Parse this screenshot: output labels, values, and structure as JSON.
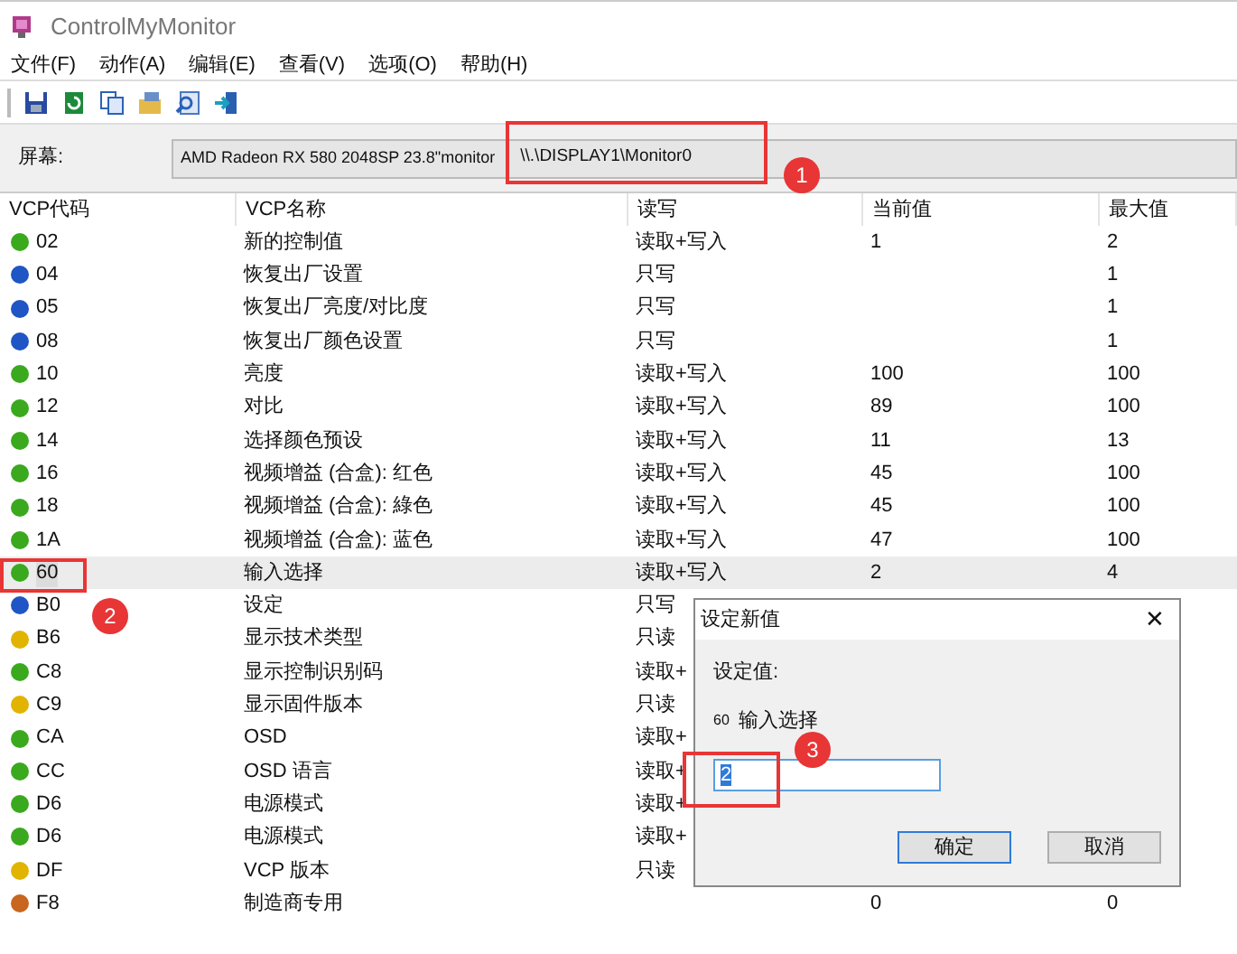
{
  "window": {
    "title": "ControlMyMonitor"
  },
  "menu": [
    "文件(F)",
    "动作(A)",
    "编辑(E)",
    "查看(V)",
    "选项(O)",
    "帮助(H)"
  ],
  "screen": {
    "label": "屏幕:",
    "monitor": "AMD Radeon RX 580 2048SP  23.8\"monitor",
    "device": "\\\\.\\DISPLAY1\\Monitor0"
  },
  "table": {
    "columns": [
      "VCP代码",
      "VCP名称",
      "读写",
      "当前值",
      "最大值"
    ],
    "rows": [
      {
        "code": "02",
        "name": "新的控制值",
        "rw": "读取+写入",
        "current": "1",
        "max": "2",
        "color": "#3aa91e",
        "selected": false
      },
      {
        "code": "04",
        "name": "恢复出厂设置",
        "rw": "只写",
        "max": "1",
        "color": "#1f55c4",
        "selected": false
      },
      {
        "code": "05",
        "name": "恢复出厂亮度/对比度",
        "rw": "只写",
        "max": "1",
        "color": "#1f55c4",
        "selected": false
      },
      {
        "code": "08",
        "name": "恢复出厂颜色设置",
        "rw": "只写",
        "max": "1",
        "color": "#1f55c4",
        "selected": false
      },
      {
        "code": "10",
        "name": "亮度",
        "rw": "读取+写入",
        "current": "100",
        "max": "100",
        "color": "#3aa91e",
        "selected": false
      },
      {
        "code": "12",
        "name": "对比",
        "rw": "读取+写入",
        "current": "89",
        "max": "100",
        "color": "#3aa91e",
        "selected": false
      },
      {
        "code": "14",
        "name": "选择颜色预设",
        "rw": "读取+写入",
        "current": "11",
        "max": "13",
        "color": "#3aa91e",
        "selected": false
      },
      {
        "code": "16",
        "name": "视频增益 (合盒): 红色",
        "rw": "读取+写入",
        "current": "45",
        "max": "100",
        "color": "#3aa91e",
        "selected": false
      },
      {
        "code": "18",
        "name": "视频增益 (合盒): 綠色",
        "rw": "读取+写入",
        "current": "45",
        "max": "100",
        "color": "#3aa91e",
        "selected": false
      },
      {
        "code": "1A",
        "name": "视频增益 (合盒): 蓝色",
        "rw": "读取+写入",
        "current": "47",
        "max": "100",
        "color": "#3aa91e",
        "selected": false
      },
      {
        "code": "60",
        "name": "输入选择",
        "rw": "读取+写入",
        "current": "2",
        "max": "4",
        "color": "#3aa91e",
        "selected": true
      },
      {
        "code": "B0",
        "name": "设定",
        "rw": "只写",
        "color": "#1f55c4",
        "selected": false
      },
      {
        "code": "B6",
        "name": "显示技术类型",
        "rw": "只读",
        "color": "#e0b400",
        "selected": false
      },
      {
        "code": "C8",
        "name": "显示控制识别码",
        "rw": "读取+",
        "color": "#3aa91e",
        "selected": false
      },
      {
        "code": "C9",
        "name": "显示固件版本",
        "rw": "只读",
        "color": "#e0b400",
        "selected": false
      },
      {
        "code": "CA",
        "name": "OSD",
        "rw": "读取+",
        "color": "#3aa91e",
        "selected": false
      },
      {
        "code": "CC",
        "name": "OSD 语言",
        "rw": "读取+",
        "color": "#3aa91e",
        "selected": false
      },
      {
        "code": "D6",
        "name": "电源模式",
        "rw": "读取+",
        "color": "#3aa91e",
        "selected": false
      },
      {
        "code": "D6",
        "name": "电源模式",
        "rw": "读取+",
        "color": "#3aa91e",
        "selected": false
      },
      {
        "code": "DF",
        "name": "VCP 版本",
        "rw": "只读",
        "color": "#e0b400",
        "selected": false
      },
      {
        "code": "F8",
        "name": "制造商专用",
        "current": "0",
        "max": "0",
        "color": "#c8651e",
        "selected": false
      }
    ]
  },
  "dialog": {
    "title": "设定新值",
    "close": "✕",
    "label": "设定值:",
    "code": "60",
    "name": "输入选择",
    "value": "2",
    "buttons": [
      {
        "label": "确定",
        "default": true
      },
      {
        "label": "取消",
        "default": false
      }
    ]
  },
  "annotations": [
    {
      "label": "1"
    },
    {
      "label": "2"
    },
    {
      "label": "3"
    }
  ]
}
